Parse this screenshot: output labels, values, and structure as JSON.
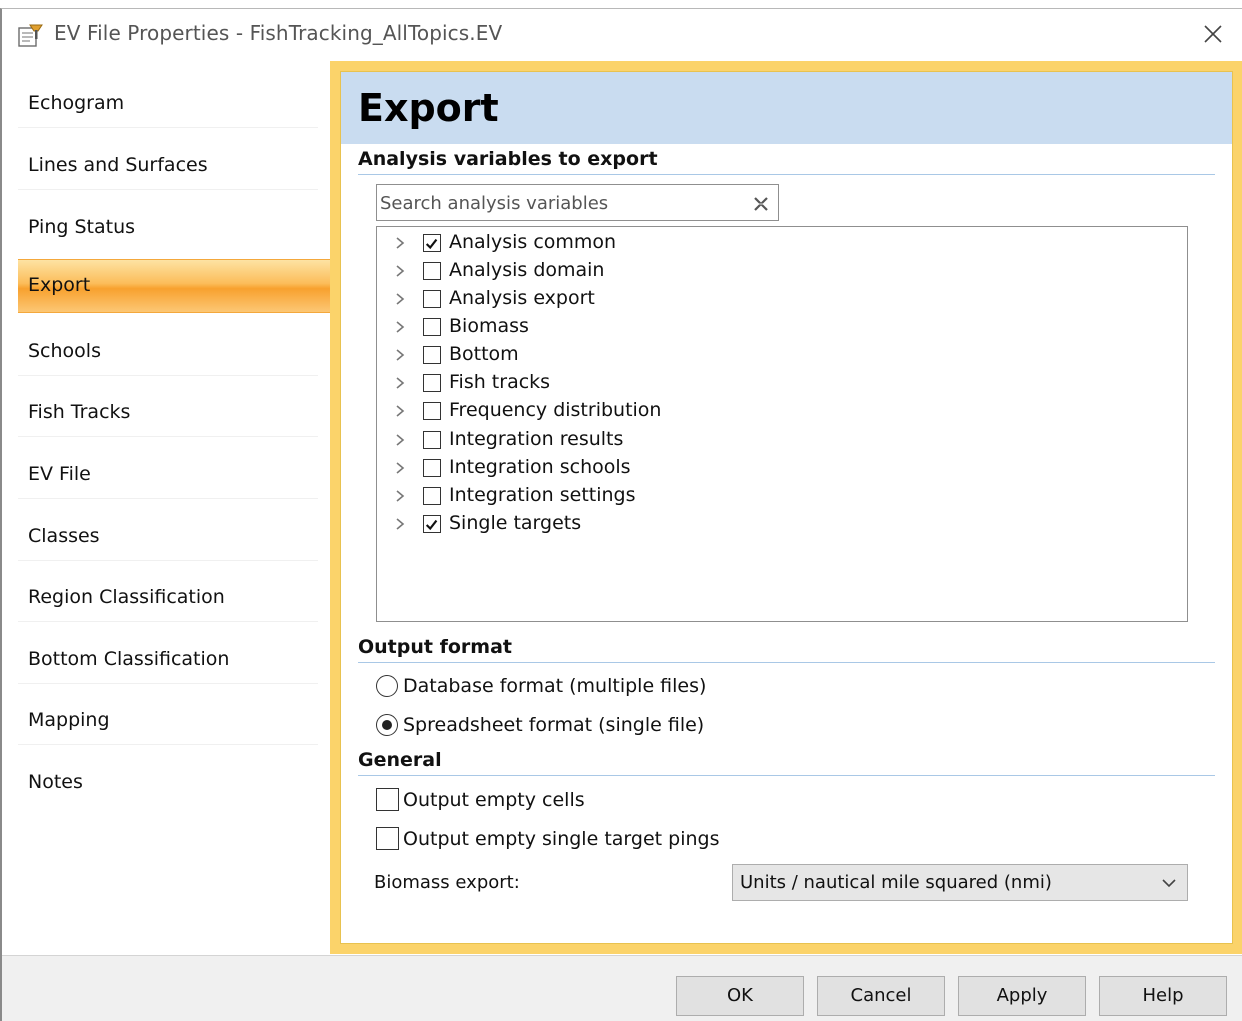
{
  "window": {
    "title": "EV File Properties - FishTracking_AllTopics.EV",
    "app_icon": "properties-icon",
    "close_icon": "close-icon"
  },
  "sidebar": {
    "items": [
      {
        "label": "Echogram",
        "active": false
      },
      {
        "label": "Lines and Surfaces",
        "active": false
      },
      {
        "label": "Ping Status",
        "active": false
      },
      {
        "label": "Export",
        "active": true
      },
      {
        "label": "Schools",
        "active": false
      },
      {
        "label": "Fish Tracks",
        "active": false
      },
      {
        "label": "EV File",
        "active": false
      },
      {
        "label": "Classes",
        "active": false
      },
      {
        "label": "Region Classification",
        "active": false
      },
      {
        "label": "Bottom Classification",
        "active": false
      },
      {
        "label": "Mapping",
        "active": false
      },
      {
        "label": "Notes",
        "active": false
      }
    ],
    "active_color": "#f8a12e"
  },
  "panel": {
    "title": "Export",
    "header_color": "#c9dcf0",
    "border_color": "#fbd36a",
    "analysis_section": {
      "title": "Analysis variables to export",
      "search_placeholder": "Search analysis variables",
      "search_value": "",
      "variables": [
        {
          "label": "Analysis common",
          "checked": true
        },
        {
          "label": "Analysis domain",
          "checked": false
        },
        {
          "label": "Analysis export",
          "checked": false
        },
        {
          "label": "Biomass",
          "checked": false
        },
        {
          "label": "Bottom",
          "checked": false
        },
        {
          "label": "Fish tracks",
          "checked": false
        },
        {
          "label": "Frequency distribution",
          "checked": false
        },
        {
          "label": "Integration results",
          "checked": false
        },
        {
          "label": "Integration schools",
          "checked": false
        },
        {
          "label": "Integration settings",
          "checked": false
        },
        {
          "label": "Single targets",
          "checked": true
        }
      ]
    },
    "output_section": {
      "title": "Output format",
      "options": [
        {
          "label": "Database format (multiple files)",
          "selected": false
        },
        {
          "label": "Spreadsheet format (single file)",
          "selected": true
        }
      ]
    },
    "general_section": {
      "title": "General",
      "checkboxes": [
        {
          "label": "Output empty cells",
          "checked": false
        },
        {
          "label": "Output empty single target pings",
          "checked": false
        }
      ],
      "biomass_label": "Biomass export:",
      "biomass_value": "Units / nautical mile squared  (nmi)"
    }
  },
  "footer": {
    "ok": "OK",
    "cancel": "Cancel",
    "apply": "Apply",
    "help": "Help"
  }
}
